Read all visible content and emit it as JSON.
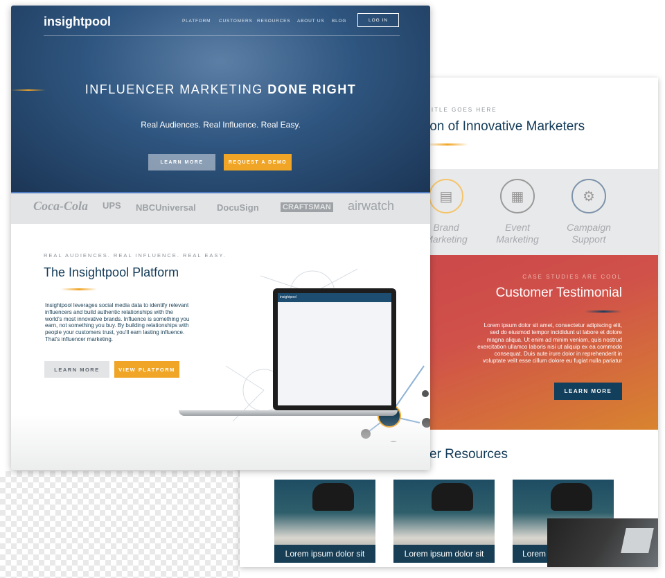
{
  "hero": {
    "logo": "insightpool",
    "nav": [
      "PLATFORM",
      "CUSTOMERS",
      "RESOURCES",
      "ABOUT US",
      "BLOG"
    ],
    "login": "LOG IN",
    "title_light": "INFLUENCER MARKETING ",
    "title_bold": "DONE RIGHT",
    "subtitle": "Real Audiences. Real Influence. Real Easy.",
    "learn_more": "LEARN MORE",
    "request_demo": "REQUEST A DEMO"
  },
  "brands": [
    "Coca-Cola",
    "UPS",
    "NBCUniversal",
    "DocuSign",
    "CRAFTSMAN",
    "airwatch"
  ],
  "platform": {
    "eyebrow": "REAL AUDIENCES. REAL INFLUENCE. REAL EASY.",
    "title": "The Insightpool Platform",
    "body": "Insightpool leverages social media data to identify relevant influencers and build authentic relationships with the world's most innovative brands. Influence is something you earn, not something you buy. By building relationships with people your customers trust, you'll earn lasting influence. That's influencer marketing.",
    "learn_more": "LEARN MORE",
    "view_platform": "VIEW PLATFORM",
    "laptop_brand": "insightpool"
  },
  "back": {
    "eyebrow": "TITLE GOES HERE",
    "title": "ion of Innovative Marketers",
    "services": [
      {
        "label": "Brand Marketing",
        "icon": "chat-icon"
      },
      {
        "label": "Event Marketing",
        "icon": "calendar-icon"
      },
      {
        "label": "Campaign Support",
        "icon": "gear-wrench-icon"
      }
    ],
    "testimonial": {
      "eyebrow": "CASE STUDIES ARE COOL",
      "title": "Customer Testimonial",
      "body": "Lorem ipsum dolor sit amet, consectetur adipiscing elit, sed do eiusmod tempor incididunt ut labore et dolore magna aliqua. Ut enim ad minim veniam, quis nostrud exercitation ullamco laboris nisi ut aliquip ex ea commodo consequat. Duis aute irure dolor in reprehenderit in voluptate velit esse cillum dolore eu fugiat nulla pariatur",
      "button": "LEARN MORE"
    },
    "resources_title": "er Resources",
    "resources": [
      "Lorem ipsum dolor sit",
      "Lorem ipsum dolor sit",
      "Lorem"
    ]
  },
  "colors": {
    "navy": "#123a57",
    "orange": "#f0a526",
    "red": "#c8454a"
  }
}
